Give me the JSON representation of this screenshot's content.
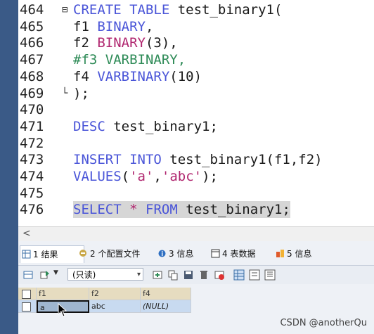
{
  "editor": {
    "lines": [
      {
        "num": "464",
        "fold": "⊟",
        "parts": [
          [
            "kw",
            "CREATE TABLE "
          ],
          [
            "txt",
            "test_binary1("
          ]
        ]
      },
      {
        "num": "465",
        "fold": "",
        "parts": [
          [
            "txt",
            "f1 "
          ],
          [
            "kw",
            "BINARY"
          ],
          [
            "txt",
            ","
          ]
        ]
      },
      {
        "num": "466",
        "fold": "",
        "parts": [
          [
            "txt",
            "f2 "
          ],
          [
            "str",
            "BINARY"
          ],
          [
            "txt",
            "(3),"
          ]
        ]
      },
      {
        "num": "467",
        "fold": "",
        "parts": [
          [
            "cmt",
            "#f3 VARBINARY,"
          ]
        ]
      },
      {
        "num": "468",
        "fold": "",
        "parts": [
          [
            "txt",
            "f4 "
          ],
          [
            "kw",
            "VARBINARY"
          ],
          [
            "txt",
            "(10)"
          ]
        ]
      },
      {
        "num": "469",
        "fold": "└",
        "parts": [
          [
            "txt",
            ");"
          ]
        ]
      },
      {
        "num": "470",
        "fold": "",
        "parts": []
      },
      {
        "num": "471",
        "fold": "",
        "parts": [
          [
            "kw",
            "DESC "
          ],
          [
            "txt",
            "test_binary1;"
          ]
        ]
      },
      {
        "num": "472",
        "fold": "",
        "parts": []
      },
      {
        "num": "473",
        "fold": "",
        "parts": [
          [
            "kw",
            "INSERT INTO "
          ],
          [
            "txt",
            "test_binary1(f1,f2)"
          ]
        ]
      },
      {
        "num": "474",
        "fold": "",
        "parts": [
          [
            "kw",
            "VALUES"
          ],
          [
            "txt",
            "("
          ],
          [
            "str",
            "'a'"
          ],
          [
            "txt",
            ","
          ],
          [
            "str",
            "'abc'"
          ],
          [
            "txt",
            ");"
          ]
        ]
      },
      {
        "num": "475",
        "fold": "",
        "parts": []
      },
      {
        "num": "476",
        "fold": "",
        "selected": true,
        "parts": [
          [
            "kw",
            "SELECT"
          ],
          [
            "txt",
            " "
          ],
          [
            "str",
            "*"
          ],
          [
            "txt",
            " "
          ],
          [
            "kw",
            "FROM"
          ],
          [
            "txt",
            " test_binary1;"
          ]
        ]
      }
    ]
  },
  "scroll": {
    "left_arrow": "<"
  },
  "tabs": [
    {
      "label": "1 结果",
      "icon": "result-grid-icon",
      "active": true
    },
    {
      "label": "2 个配置文件",
      "icon": "profile-icon",
      "active": false
    },
    {
      "label": "3 信息",
      "icon": "info-icon",
      "active": false
    },
    {
      "label": "4 表数据",
      "icon": "table-data-icon",
      "active": false
    },
    {
      "label": "5 信息",
      "icon": "info-alt-icon",
      "active": false
    }
  ],
  "toolbar": {
    "readonly_select": "(只读)"
  },
  "grid": {
    "columns": [
      "f1",
      "f2",
      "f4"
    ],
    "rows": [
      [
        "a",
        "abc",
        "(NULL)"
      ]
    ]
  },
  "watermark": "CSDN @anotherQu",
  "colors": {
    "keyword": "#4a55d8",
    "string": "#b0266f",
    "comment": "#2e8b57"
  }
}
